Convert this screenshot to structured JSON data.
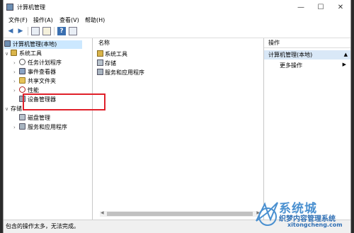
{
  "window": {
    "title": "计算机管理",
    "minimize": "—",
    "maximize": "☐",
    "close": "✕"
  },
  "menu": [
    "文件(F)",
    "操作(A)",
    "查看(V)",
    "帮助(H)"
  ],
  "tree": {
    "root": "计算机管理(本地)",
    "system_tools": "系统工具",
    "task_scheduler": "任务计划程序",
    "event_viewer": "事件查看器",
    "shared_folders": "共享文件夹",
    "performance": "性能",
    "device_manager": "设备管理器",
    "storage": "存储",
    "disk_management": "磁盘管理",
    "services": "服务和应用程序"
  },
  "middle": {
    "header": "名称",
    "rows": [
      "系统工具",
      "存储",
      "服务和应用程序"
    ]
  },
  "actions": {
    "header": "操作",
    "selected": "计算机管理(本地)",
    "more": "更多操作"
  },
  "status": "包含的操作太多，无法完成。",
  "watermark": {
    "brand": "系统城",
    "sub": "织梦内容管理系统",
    "url": "xitongcheng.com"
  },
  "colors": {
    "selection": "#cce8ff",
    "highlight_box": "#e0202a",
    "watermark": "#4a90d0"
  }
}
